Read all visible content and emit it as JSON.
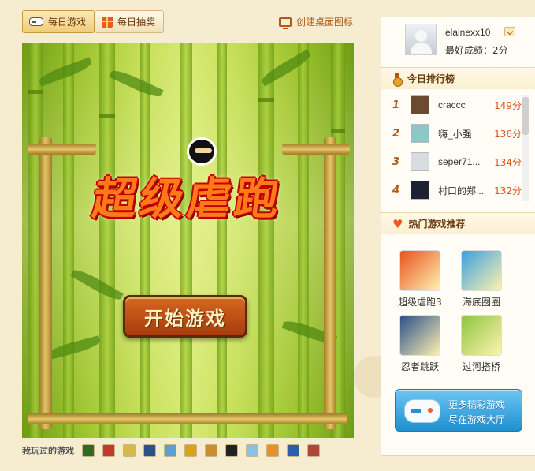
{
  "topbar": {
    "tab_daily_games": "每日游戏",
    "tab_daily_lottery": "每日抽奖",
    "desktop_icon_link": "创建桌面图标"
  },
  "game": {
    "title": "超级虐跑",
    "start_button": "开始游戏"
  },
  "played": {
    "label": "我玩过的游戏",
    "thumb_colors": [
      "#2f6a22",
      "#c0392b",
      "#d9b84a",
      "#2a4f8a",
      "#5a9fd4",
      "#d8a21a",
      "#c98e2e",
      "#222222",
      "#89c0e6",
      "#e8902a",
      "#2c5fa8",
      "#b0453a"
    ]
  },
  "user": {
    "username": "elainexx10",
    "best_label": "最好成绩：",
    "best_value": "2分"
  },
  "ranking": {
    "title": "今日排行榜",
    "rows": [
      {
        "rank": "1",
        "name": "craccc",
        "score": "149分",
        "avatar_color": "#6b4a2f"
      },
      {
        "rank": "2",
        "name": "嗨_小强",
        "score": "136分",
        "avatar_color": "#8fc7c9"
      },
      {
        "rank": "3",
        "name": "seper71...",
        "score": "134分",
        "avatar_color": "#d7dbe2"
      },
      {
        "rank": "4",
        "name": "村口的郑...",
        "score": "132分",
        "avatar_color": "#1b2230"
      }
    ]
  },
  "hot": {
    "title": "热门游戏推荐",
    "games": [
      {
        "name": "超级虐跑3",
        "color": "#e8531f"
      },
      {
        "name": "海底圈圈",
        "color": "#3aa0e0"
      },
      {
        "name": "忍者跳跃",
        "color": "#2a4f8a"
      },
      {
        "name": "过河搭桥",
        "color": "#8cc63f"
      }
    ]
  },
  "more": {
    "line1": "更多精彩游戏",
    "line2": "尽在游戏大厅"
  },
  "colors": {
    "accent": "#b25a18",
    "score": "#d9561c",
    "page_bg": "#f6ecd0"
  }
}
